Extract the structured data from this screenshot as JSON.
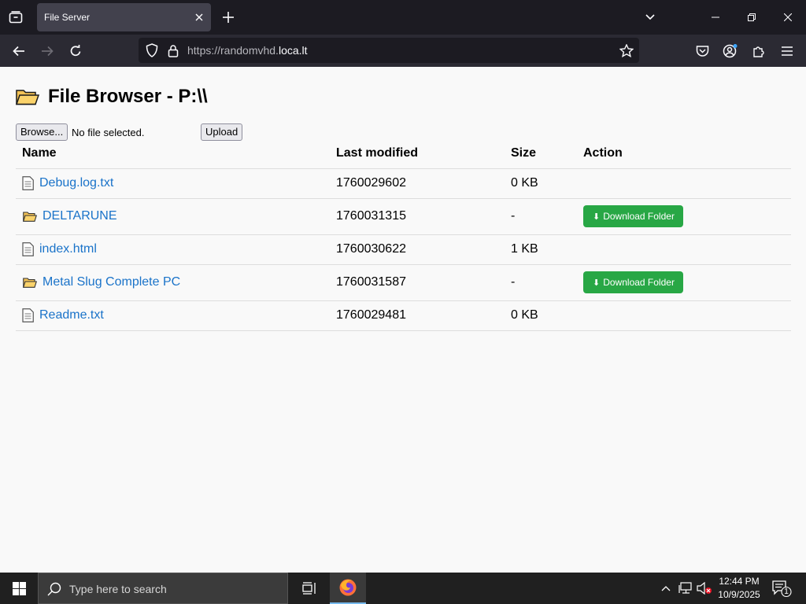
{
  "browser": {
    "tab_title": "File Server",
    "url_prefix": "https://randomvhd.",
    "url_domain": "loca.lt"
  },
  "page": {
    "title": "File Browser - P:\\\\",
    "browse_label": "Browse...",
    "file_status": "No file selected.",
    "upload_label": "Upload"
  },
  "table": {
    "headers": {
      "name": "Name",
      "modified": "Last modified",
      "size": "Size",
      "action": "Action"
    },
    "rows": [
      {
        "type": "file",
        "name": "Debug.log.txt",
        "modified": "1760029602",
        "size": "0 KB"
      },
      {
        "type": "folder",
        "name": "DELTARUNE",
        "modified": "1760031315",
        "size": "-",
        "action": "Download Folder"
      },
      {
        "type": "file",
        "name": "index.html",
        "modified": "1760030622",
        "size": "1 KB"
      },
      {
        "type": "folder",
        "name": "Metal Slug Complete PC",
        "modified": "1760031587",
        "size": "-",
        "action": "Download Folder"
      },
      {
        "type": "file",
        "name": "Readme.txt",
        "modified": "1760029481",
        "size": "0 KB"
      }
    ]
  },
  "taskbar": {
    "search_placeholder": "Type here to search",
    "time": "12:44 PM",
    "date": "10/9/2025",
    "notification_count": "1"
  },
  "colors": {
    "link": "#1a73c9",
    "download_button": "#28a745",
    "browser_dark": "#1c1b22",
    "toolbar": "#2b2a33"
  }
}
